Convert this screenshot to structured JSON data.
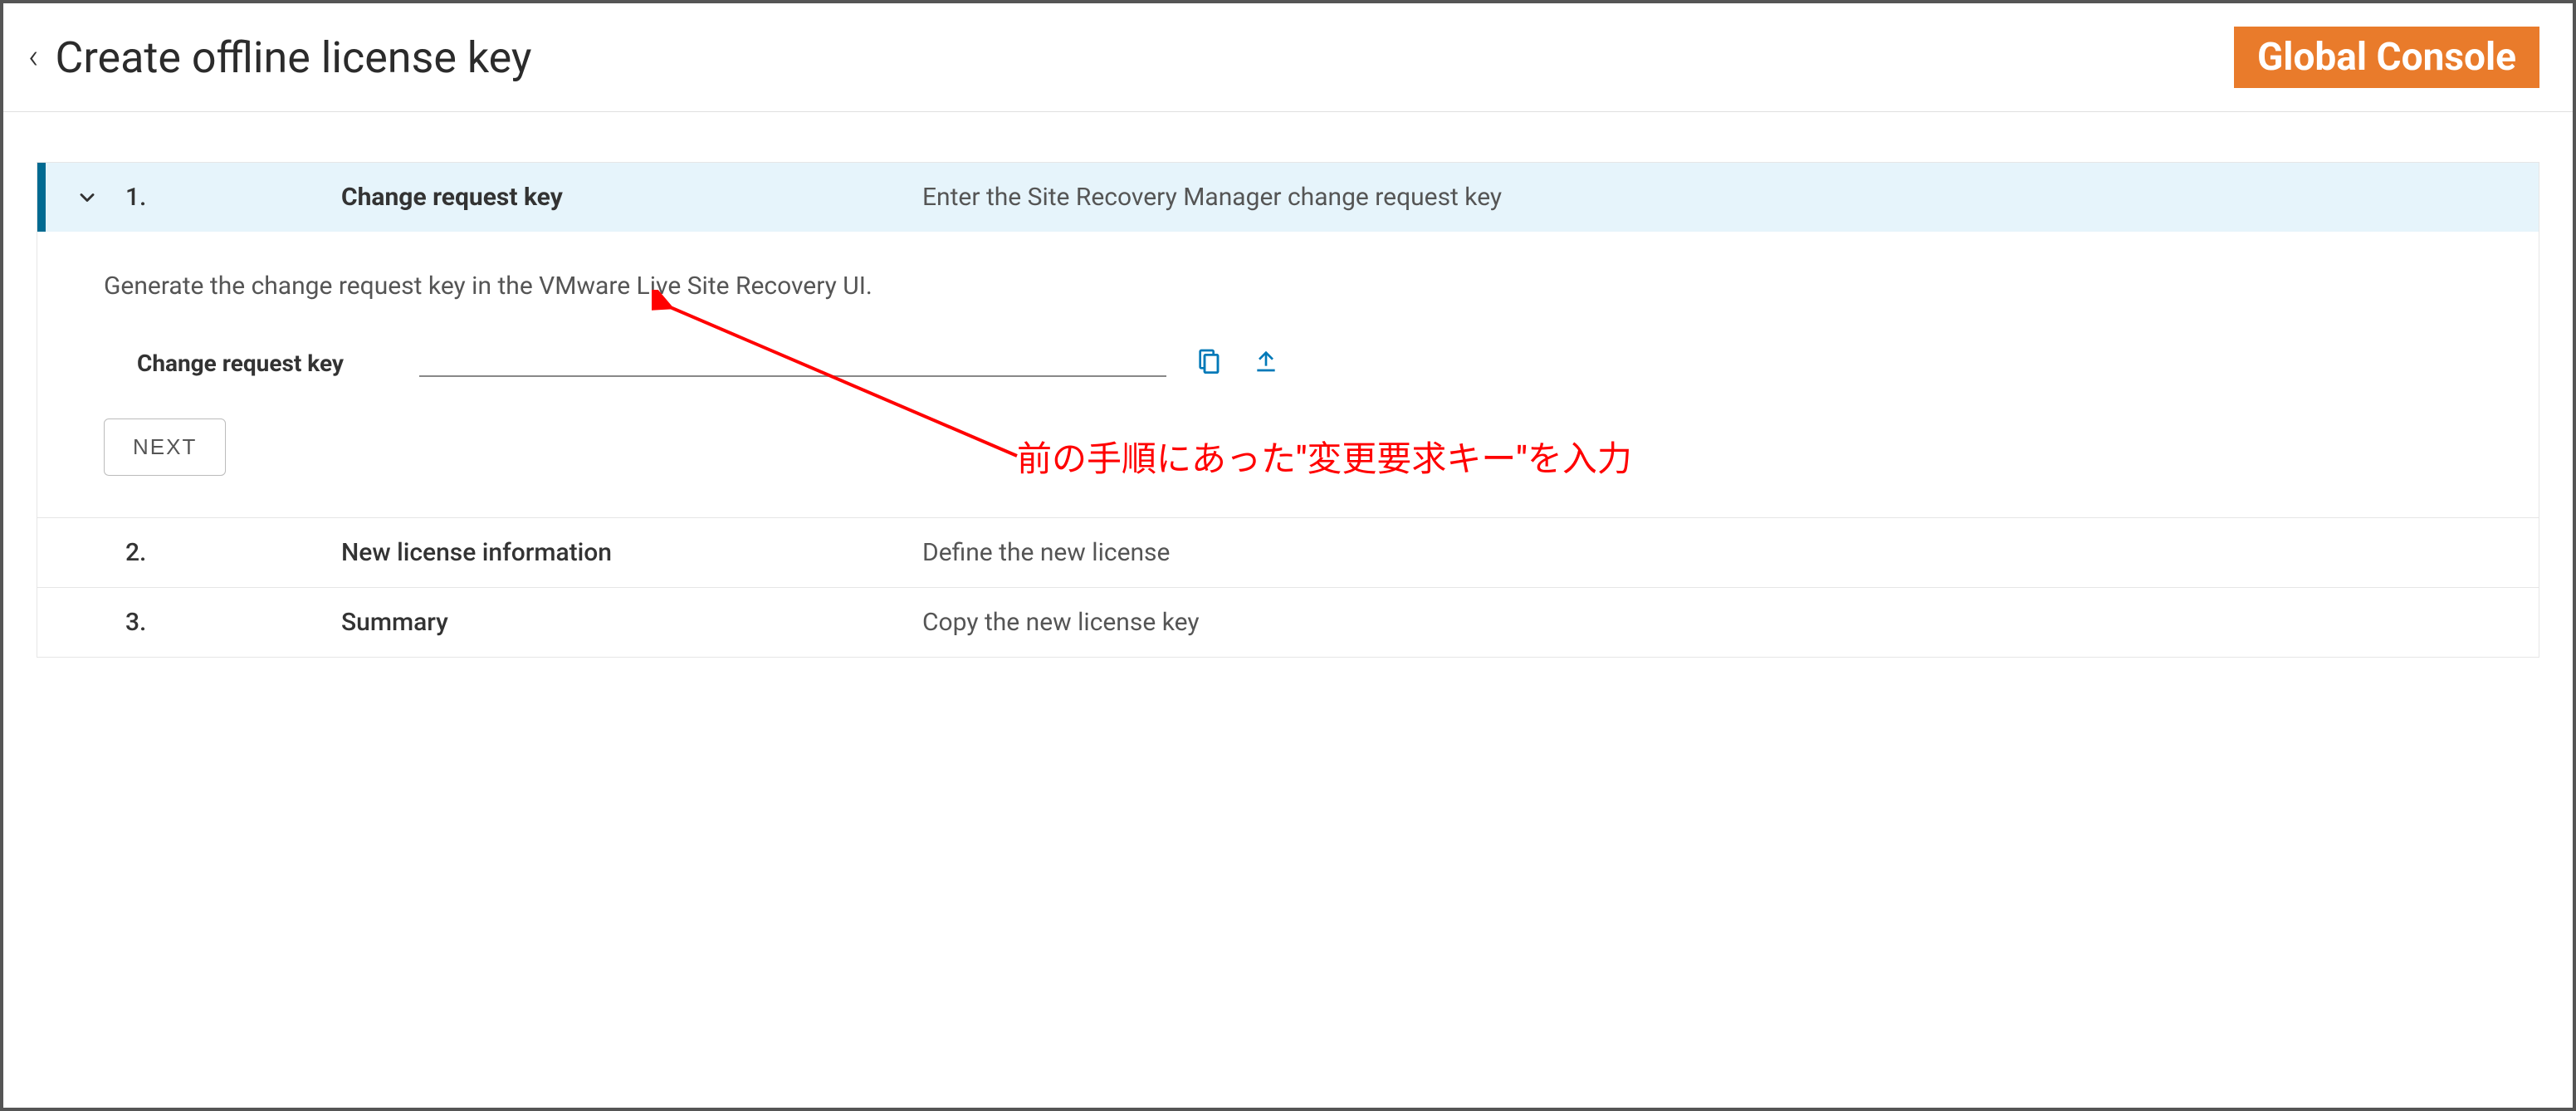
{
  "header": {
    "back_icon": "‹",
    "title": "Create offline license key",
    "global_badge": "Global Console"
  },
  "steps": [
    {
      "num": "1.",
      "title": "Change request key",
      "desc": "Enter the Site Recovery Manager change request key",
      "active": true
    },
    {
      "num": "2.",
      "title": "New license information",
      "desc": "Define the new license",
      "active": false
    },
    {
      "num": "3.",
      "title": "Summary",
      "desc": "Copy the new license key",
      "active": false
    }
  ],
  "step1": {
    "generate_text": "Generate the change request key in the VMware Live Site Recovery UI.",
    "field_label": "Change request key",
    "field_value": "",
    "next_label": "NEXT"
  },
  "annotation": {
    "text": "前の手順にあった\"変更要求キー\"を入力"
  },
  "colors": {
    "accent": "#006a91",
    "badge": "#e97b2b",
    "link": "#0079b8",
    "annotation": "#ff0000"
  }
}
